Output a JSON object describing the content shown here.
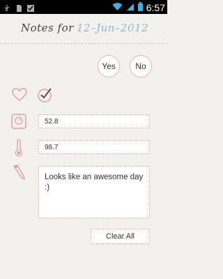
{
  "status_bar": {
    "time": "6:57",
    "left_icons": [
      "usb-icon",
      "sd-card-icon",
      "checkbox-icon"
    ],
    "right_icons": [
      "wifi-icon",
      "signal-icon",
      "battery-icon"
    ]
  },
  "header": {
    "title": "Notes for",
    "date": "12–Jun–2012"
  },
  "answer_buttons": {
    "yes_label": "Yes",
    "no_label": "No"
  },
  "fields": {
    "weight_value": "52.8",
    "temperature_value": "98.7",
    "note_value": "Looks like an awesome day :)"
  },
  "actions": {
    "clear_all_label": "Clear All"
  },
  "colors": {
    "accent_pink": "#e7a9a9",
    "date_blue": "#8fbcd0"
  }
}
